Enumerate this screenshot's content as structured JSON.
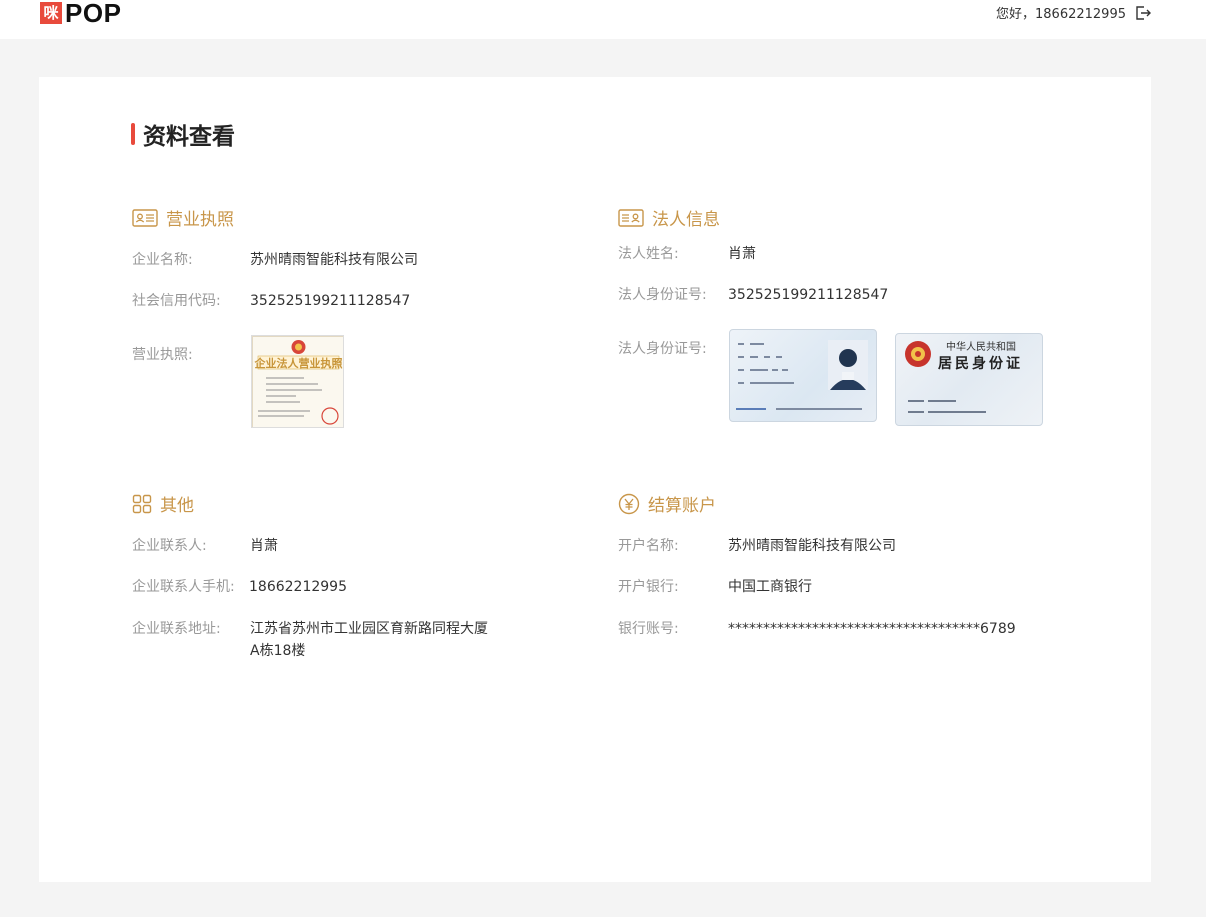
{
  "header": {
    "logo_mark": "咪",
    "logo_text": "POP",
    "greeting": "您好，18662212995"
  },
  "page_title": "资料查看",
  "business_license": {
    "heading": "营业执照",
    "company_name_label": "企业名称:",
    "company_name": "苏州晴雨智能科技有限公司",
    "credit_code_label": "社会信用代码:",
    "credit_code": "352525199211128547",
    "license_image_label": "营业执照:",
    "thumb_title": "企业法人营业执照"
  },
  "legal_person": {
    "heading": "法人信息",
    "name_label": "法人姓名:",
    "name": "肖萧",
    "id_label": "法人身份证号:",
    "id": "352525199211128547",
    "id_image_label": "法人身份证号:",
    "id_back_line1": "中华人民共和国",
    "id_back_line2": "居民身份证"
  },
  "other": {
    "heading": "其他",
    "contact_label": "企业联系人:",
    "contact": "肖萧",
    "phone_label": "企业联系人手机:",
    "phone": "18662212995",
    "address_label": "企业联系地址:",
    "address": "江苏省苏州市工业园区育新路同程大厦A栋18楼"
  },
  "settlement": {
    "heading": "结算账户",
    "account_name_label": "开户名称:",
    "account_name": "苏州晴雨智能科技有限公司",
    "bank_label": "开户银行:",
    "bank": "中国工商银行",
    "account_no_label": "银行账号:",
    "account_no": "************************************6789"
  },
  "colors": {
    "accent": "#e84a3c",
    "section": "#c8964a",
    "background": "#f4f4f4"
  }
}
